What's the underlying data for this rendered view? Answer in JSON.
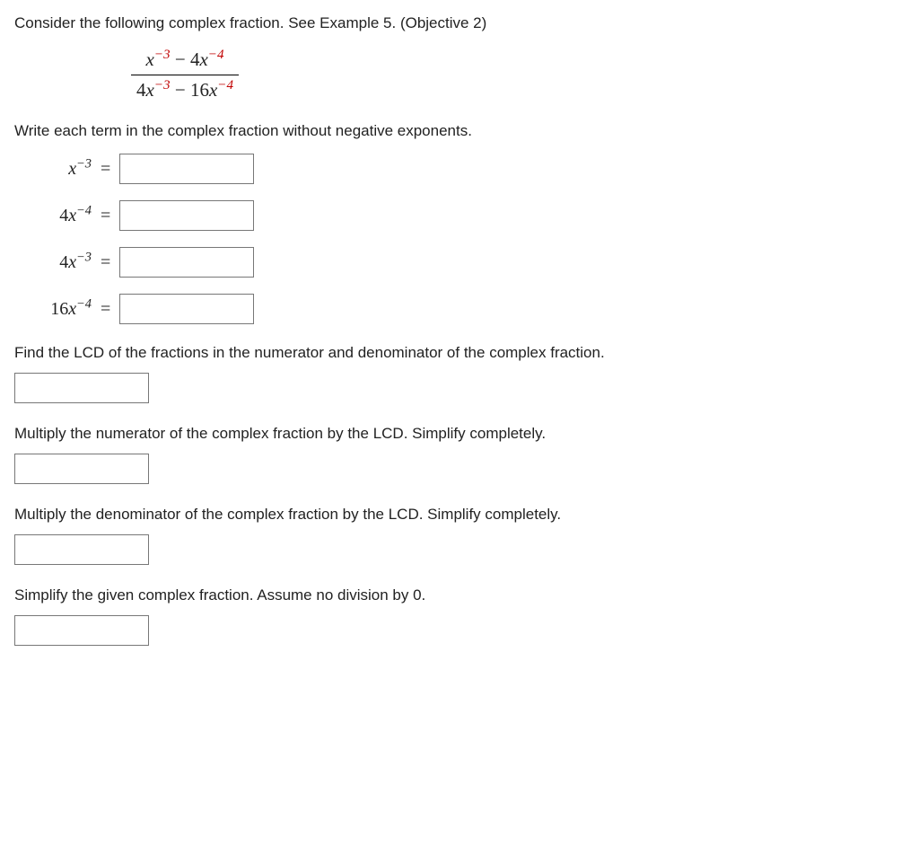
{
  "intro": "Consider the following complex fraction. See Example 5. (Objective 2)",
  "fraction": {
    "numerator": {
      "t1_base": "x",
      "t1_exp": "−3",
      "op": " − ",
      "t2_coef": "4",
      "t2_base": "x",
      "t2_exp": "−4"
    },
    "denominator": {
      "t1_coef": "4",
      "t1_base": "x",
      "t1_exp": "−3",
      "op": " − ",
      "t2_coef": "16",
      "t2_base": "x",
      "t2_exp": "−4"
    }
  },
  "prompt_rewrite": "Write each term in the complex fraction without negative exponents.",
  "terms": [
    {
      "coef": "",
      "base": "x",
      "exp": "−3"
    },
    {
      "coef": "4",
      "base": "x",
      "exp": "−4"
    },
    {
      "coef": "4",
      "base": "x",
      "exp": "−3"
    },
    {
      "coef": "16",
      "base": "x",
      "exp": "−4"
    }
  ],
  "equals": "=",
  "prompt_lcd": "Find the LCD of the fractions in the numerator and denominator of the complex fraction.",
  "prompt_mult_num": "Multiply the numerator of the complex fraction by the LCD. Simplify completely.",
  "prompt_mult_den": "Multiply the denominator of the complex fraction by the LCD. Simplify completely.",
  "prompt_simplify": "Simplify the given complex fraction. Assume no division by 0."
}
